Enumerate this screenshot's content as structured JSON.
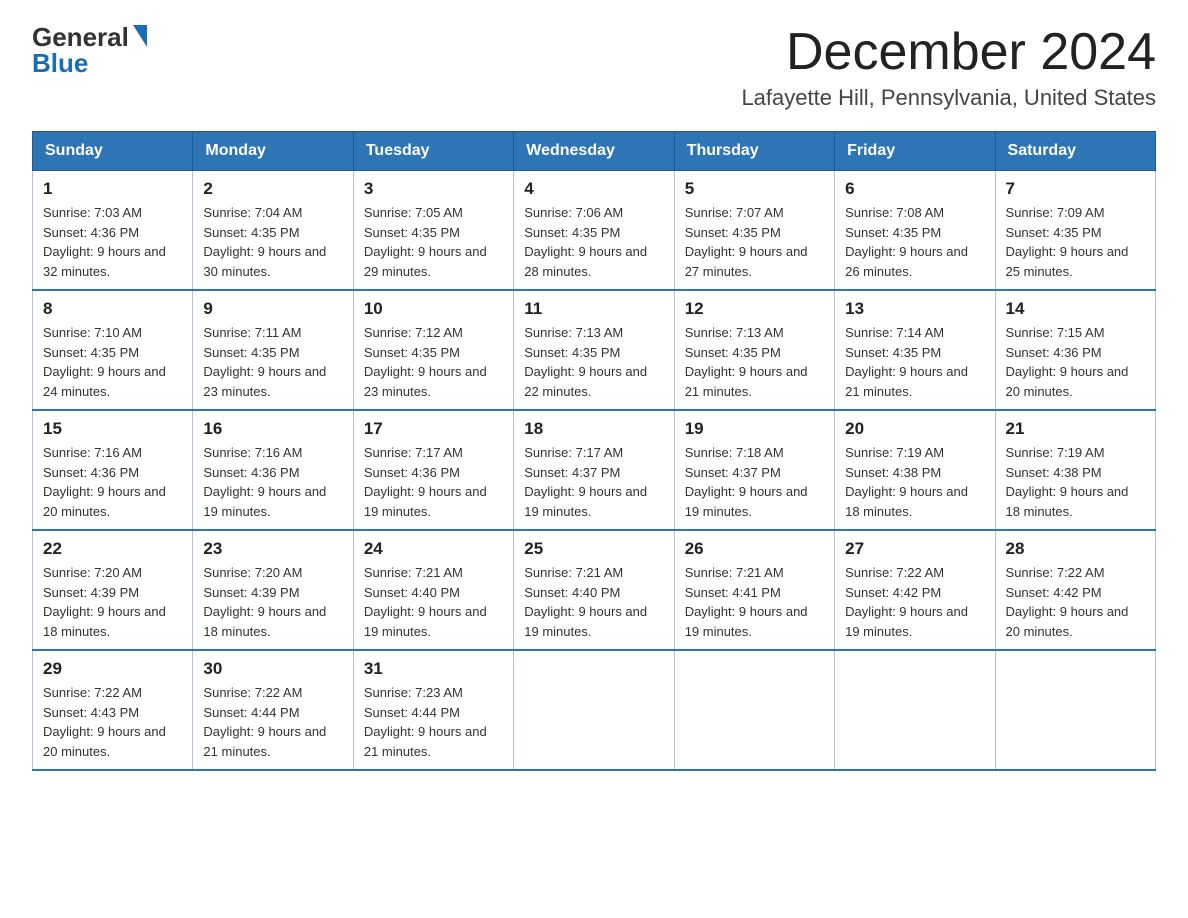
{
  "header": {
    "logo_general": "General",
    "logo_blue": "Blue",
    "month_title": "December 2024",
    "location": "Lafayette Hill, Pennsylvania, United States"
  },
  "days_of_week": [
    "Sunday",
    "Monday",
    "Tuesday",
    "Wednesday",
    "Thursday",
    "Friday",
    "Saturday"
  ],
  "weeks": [
    [
      {
        "day": "1",
        "sunrise": "7:03 AM",
        "sunset": "4:36 PM",
        "daylight": "9 hours and 32 minutes."
      },
      {
        "day": "2",
        "sunrise": "7:04 AM",
        "sunset": "4:35 PM",
        "daylight": "9 hours and 30 minutes."
      },
      {
        "day": "3",
        "sunrise": "7:05 AM",
        "sunset": "4:35 PM",
        "daylight": "9 hours and 29 minutes."
      },
      {
        "day": "4",
        "sunrise": "7:06 AM",
        "sunset": "4:35 PM",
        "daylight": "9 hours and 28 minutes."
      },
      {
        "day": "5",
        "sunrise": "7:07 AM",
        "sunset": "4:35 PM",
        "daylight": "9 hours and 27 minutes."
      },
      {
        "day": "6",
        "sunrise": "7:08 AM",
        "sunset": "4:35 PM",
        "daylight": "9 hours and 26 minutes."
      },
      {
        "day": "7",
        "sunrise": "7:09 AM",
        "sunset": "4:35 PM",
        "daylight": "9 hours and 25 minutes."
      }
    ],
    [
      {
        "day": "8",
        "sunrise": "7:10 AM",
        "sunset": "4:35 PM",
        "daylight": "9 hours and 24 minutes."
      },
      {
        "day": "9",
        "sunrise": "7:11 AM",
        "sunset": "4:35 PM",
        "daylight": "9 hours and 23 minutes."
      },
      {
        "day": "10",
        "sunrise": "7:12 AM",
        "sunset": "4:35 PM",
        "daylight": "9 hours and 23 minutes."
      },
      {
        "day": "11",
        "sunrise": "7:13 AM",
        "sunset": "4:35 PM",
        "daylight": "9 hours and 22 minutes."
      },
      {
        "day": "12",
        "sunrise": "7:13 AM",
        "sunset": "4:35 PM",
        "daylight": "9 hours and 21 minutes."
      },
      {
        "day": "13",
        "sunrise": "7:14 AM",
        "sunset": "4:35 PM",
        "daylight": "9 hours and 21 minutes."
      },
      {
        "day": "14",
        "sunrise": "7:15 AM",
        "sunset": "4:36 PM",
        "daylight": "9 hours and 20 minutes."
      }
    ],
    [
      {
        "day": "15",
        "sunrise": "7:16 AM",
        "sunset": "4:36 PM",
        "daylight": "9 hours and 20 minutes."
      },
      {
        "day": "16",
        "sunrise": "7:16 AM",
        "sunset": "4:36 PM",
        "daylight": "9 hours and 19 minutes."
      },
      {
        "day": "17",
        "sunrise": "7:17 AM",
        "sunset": "4:36 PM",
        "daylight": "9 hours and 19 minutes."
      },
      {
        "day": "18",
        "sunrise": "7:17 AM",
        "sunset": "4:37 PM",
        "daylight": "9 hours and 19 minutes."
      },
      {
        "day": "19",
        "sunrise": "7:18 AM",
        "sunset": "4:37 PM",
        "daylight": "9 hours and 19 minutes."
      },
      {
        "day": "20",
        "sunrise": "7:19 AM",
        "sunset": "4:38 PM",
        "daylight": "9 hours and 18 minutes."
      },
      {
        "day": "21",
        "sunrise": "7:19 AM",
        "sunset": "4:38 PM",
        "daylight": "9 hours and 18 minutes."
      }
    ],
    [
      {
        "day": "22",
        "sunrise": "7:20 AM",
        "sunset": "4:39 PM",
        "daylight": "9 hours and 18 minutes."
      },
      {
        "day": "23",
        "sunrise": "7:20 AM",
        "sunset": "4:39 PM",
        "daylight": "9 hours and 18 minutes."
      },
      {
        "day": "24",
        "sunrise": "7:21 AM",
        "sunset": "4:40 PM",
        "daylight": "9 hours and 19 minutes."
      },
      {
        "day": "25",
        "sunrise": "7:21 AM",
        "sunset": "4:40 PM",
        "daylight": "9 hours and 19 minutes."
      },
      {
        "day": "26",
        "sunrise": "7:21 AM",
        "sunset": "4:41 PM",
        "daylight": "9 hours and 19 minutes."
      },
      {
        "day": "27",
        "sunrise": "7:22 AM",
        "sunset": "4:42 PM",
        "daylight": "9 hours and 19 minutes."
      },
      {
        "day": "28",
        "sunrise": "7:22 AM",
        "sunset": "4:42 PM",
        "daylight": "9 hours and 20 minutes."
      }
    ],
    [
      {
        "day": "29",
        "sunrise": "7:22 AM",
        "sunset": "4:43 PM",
        "daylight": "9 hours and 20 minutes."
      },
      {
        "day": "30",
        "sunrise": "7:22 AM",
        "sunset": "4:44 PM",
        "daylight": "9 hours and 21 minutes."
      },
      {
        "day": "31",
        "sunrise": "7:23 AM",
        "sunset": "4:44 PM",
        "daylight": "9 hours and 21 minutes."
      },
      null,
      null,
      null,
      null
    ]
  ]
}
